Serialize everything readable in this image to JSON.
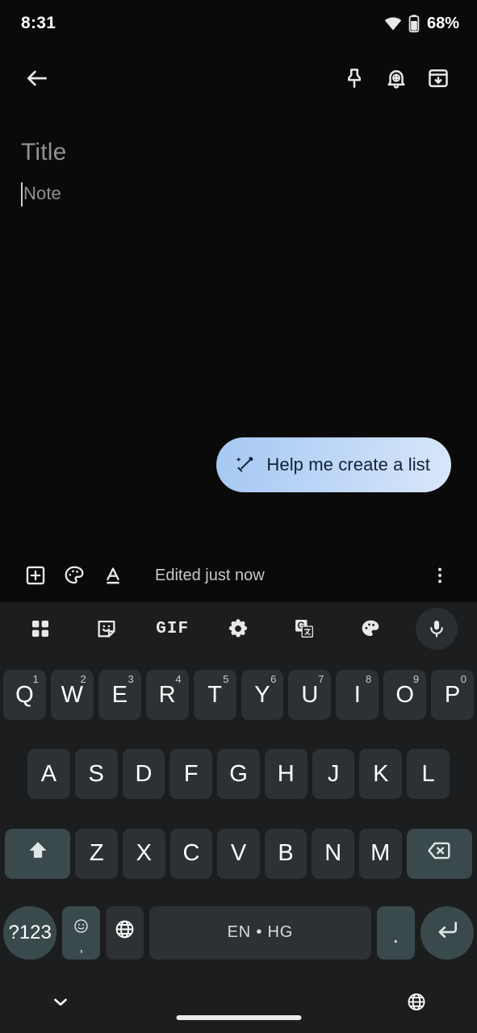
{
  "status_bar": {
    "time": "8:31",
    "battery_percent": "68%",
    "wifi_icon": "wifi-icon",
    "battery_icon": "battery-icon"
  },
  "app_bar": {
    "back_icon": "back-arrow-icon",
    "pin_icon": "pin-icon",
    "reminder_icon": "add-reminder-bell-icon",
    "archive_icon": "archive-icon"
  },
  "note": {
    "title_placeholder": "Title",
    "body_placeholder": "Note",
    "magic_chip_label": "Help me create a list",
    "magic_chip_icon": "magic-wand-icon"
  },
  "note_toolbar": {
    "add_icon": "add-box-icon",
    "palette_icon": "palette-icon",
    "text_format_icon": "text-format-icon",
    "edited_status": "Edited just now",
    "overflow_icon": "more-vertical-icon"
  },
  "keyboard": {
    "toolbar": [
      {
        "name": "apps-grid-icon",
        "label": ""
      },
      {
        "name": "sticker-icon",
        "label": ""
      },
      {
        "name": "gif-icon",
        "label": "GIF"
      },
      {
        "name": "settings-gear-icon",
        "label": ""
      },
      {
        "name": "google-translate-icon",
        "label": ""
      },
      {
        "name": "theme-palette-icon",
        "label": ""
      },
      {
        "name": "microphone-icon",
        "label": ""
      }
    ],
    "row1": [
      {
        "key": "Q",
        "sup": "1"
      },
      {
        "key": "W",
        "sup": "2"
      },
      {
        "key": "E",
        "sup": "3"
      },
      {
        "key": "R",
        "sup": "4"
      },
      {
        "key": "T",
        "sup": "5"
      },
      {
        "key": "Y",
        "sup": "6"
      },
      {
        "key": "U",
        "sup": "7"
      },
      {
        "key": "I",
        "sup": "8"
      },
      {
        "key": "O",
        "sup": "9"
      },
      {
        "key": "P",
        "sup": "0"
      }
    ],
    "row2": [
      {
        "key": "A"
      },
      {
        "key": "S"
      },
      {
        "key": "D"
      },
      {
        "key": "F"
      },
      {
        "key": "G"
      },
      {
        "key": "H"
      },
      {
        "key": "J"
      },
      {
        "key": "K"
      },
      {
        "key": "L"
      }
    ],
    "row3": [
      {
        "key": "Z"
      },
      {
        "key": "X"
      },
      {
        "key": "C"
      },
      {
        "key": "V"
      },
      {
        "key": "B"
      },
      {
        "key": "N"
      },
      {
        "key": "M"
      }
    ],
    "shift_icon": "shift-icon",
    "backspace_icon": "backspace-icon",
    "symbols_key": "?123",
    "emoji_icon": "emoji-icon",
    "comma_key": ",",
    "language_globe_icon": "globe-icon",
    "space_label": "EN • HG",
    "period_key": ".",
    "enter_icon": "enter-icon"
  },
  "nav_bar": {
    "hide_keyboard_icon": "chevron-down-icon",
    "ime_switch_icon": "globe-icon",
    "home_indicator": "home-indicator"
  },
  "colors": {
    "background": "#0a0a0a",
    "keyboard_bg": "#1b1d1f",
    "key_bg": "#2e3133",
    "modifier_key_bg": "#3a494c",
    "chip_gradient_start": "#a6c8f2",
    "chip_gradient_end": "#d9e7f9",
    "chip_text": "#11223a",
    "placeholder_text": "#8e9194",
    "icon_color": "#e6e8ea"
  }
}
